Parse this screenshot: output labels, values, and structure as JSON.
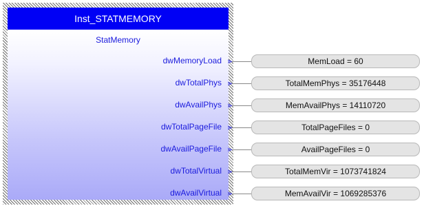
{
  "block": {
    "instance_name": "Inst_STATMEMORY",
    "type_name": "StatMemory"
  },
  "outputs": [
    {
      "pin": "dwMemoryLoad",
      "value": "MemLoad = 60"
    },
    {
      "pin": "dwTotalPhys",
      "value": "TotalMemPhys = 35176448"
    },
    {
      "pin": "dwAvailPhys",
      "value": "MemAvailPhys = 14110720"
    },
    {
      "pin": "dwTotalPageFile",
      "value": "TotalPageFiles = 0"
    },
    {
      "pin": "dwAvailPageFile",
      "value": "AvailPageFiles = 0"
    },
    {
      "pin": "dwTotalVirtual",
      "value": "TotalMemVir = 1073741824"
    },
    {
      "pin": "dwAvailVirtual",
      "value": "MemAvailVir = 1069285376"
    }
  ],
  "colors": {
    "title_bar": "#0000f5",
    "pin_text": "#1a1add",
    "value_box": "#e4e4e4"
  }
}
